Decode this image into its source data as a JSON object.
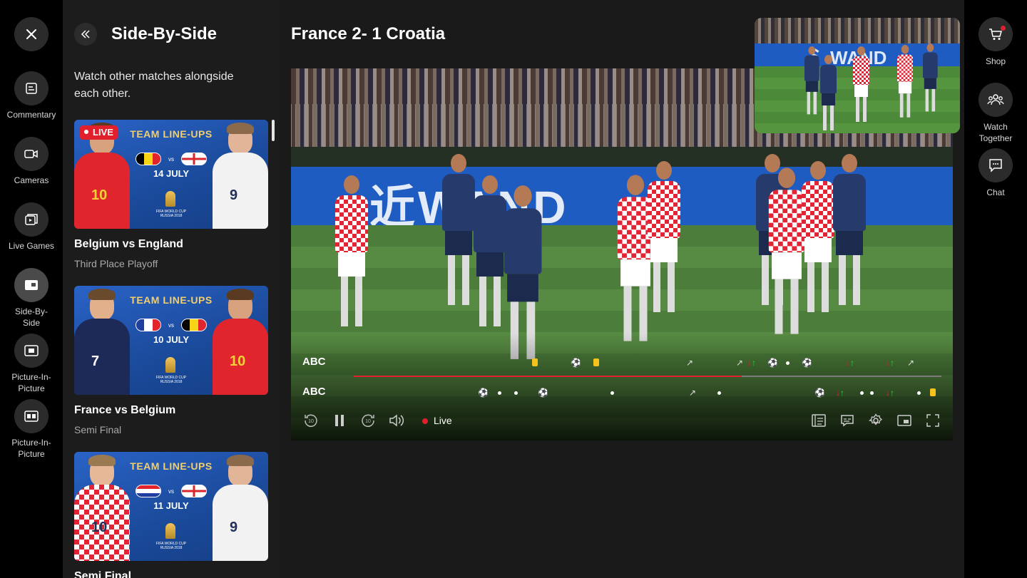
{
  "left_rail": {
    "close_label": "",
    "items": [
      {
        "label": "Commentary",
        "icon": "commentary-icon"
      },
      {
        "label": "Cameras",
        "icon": "camera-icon"
      },
      {
        "label": "Live Games",
        "icon": "live-games-icon"
      },
      {
        "label": "Side-By-Side",
        "icon": "side-by-side-icon",
        "active": true
      },
      {
        "label": "Picture-In-Picture",
        "icon": "picture-in-picture-icon"
      },
      {
        "label": "Picture-In-Picture",
        "icon": "picture-in-picture-alt-icon"
      }
    ]
  },
  "panel": {
    "title": "Side-By-Side",
    "description": "Watch other matches alongside each other.",
    "cards": [
      {
        "live_badge": "LIVE",
        "banner": "TEAM LINE-UPS",
        "vs": "vs",
        "date": "14 JULY",
        "cup": "FIFA WORLD CUP RUSSIA 2018",
        "left_number": "10",
        "right_number": "9",
        "title": "Belgium  vs England",
        "subtitle": "Third Place Playoff"
      },
      {
        "banner": "TEAM LINE-UPS",
        "vs": "vs",
        "date": "10 JULY",
        "cup": "FIFA WORLD CUP RUSSIA 2018",
        "left_number": "7",
        "right_number": "10",
        "title": "France vs Belgium",
        "subtitle": "Semi Final"
      },
      {
        "banner": "TEAM LINE-UPS",
        "vs": "vs",
        "date": "11 JULY",
        "cup": "FIFA WORLD CUP RUSSIA 2018",
        "left_number": "10",
        "right_number": "9",
        "title": "Semi Final",
        "subtitle": ""
      }
    ]
  },
  "main": {
    "match_title": "France 2- 1 Croatia",
    "banner_text": "近WAND",
    "tracks": [
      {
        "label": "ABC"
      },
      {
        "label": "ABC"
      }
    ],
    "progress": 0.66,
    "live_label": "Live"
  },
  "pip": {
    "banner_text": "氵WAND"
  },
  "right_rail": {
    "items": [
      {
        "label": "Shop",
        "icon": "cart-icon"
      },
      {
        "label": "Watch Together",
        "icon": "group-icon"
      },
      {
        "label": "Chat",
        "icon": "chat-icon"
      }
    ]
  },
  "colors": {
    "accent": "#e0202c",
    "card_yellow": "#f6c21c",
    "sub_green": "#2ecc40",
    "sub_red": "#e0202c"
  }
}
